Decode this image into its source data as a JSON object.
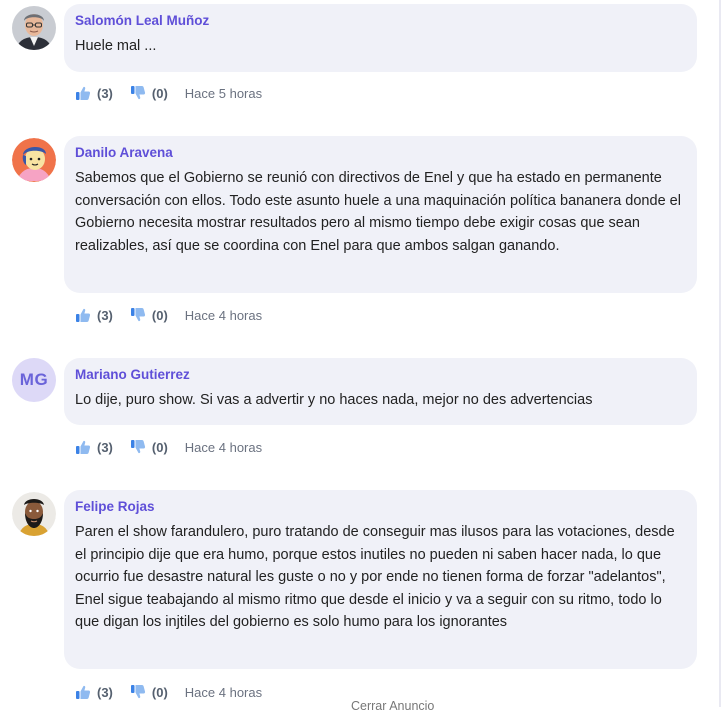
{
  "comments": [
    {
      "author": "Salomón Leal Muñoz",
      "avatar": "photo-man-glasses",
      "text": "Huele mal ...",
      "likes": "(3)",
      "dislikes": "(0)",
      "time": "Hace 5 horas"
    },
    {
      "author": "Danilo Aravena",
      "avatar": "cartoon-avatar-orange",
      "text": "Sabemos que el Gobierno se reunió con directivos de Enel y que ha estado en permanente conversación con ellos. Todo este asunto huele a una maquinación política bananera donde el Gobierno necesita mostrar resultados pero al mismo tiempo debe exigir cosas que sean realizables, así que se coordina con Enel para que ambos salgan ganando.",
      "likes": "(3)",
      "dislikes": "(0)",
      "time": "Hace 4 horas"
    },
    {
      "author": "Mariano Gutierrez",
      "avatar": "initials",
      "initials": "MG",
      "text": "Lo dije, puro show. Si vas a advertir y no haces nada, mejor no des advertencias",
      "likes": "(3)",
      "dislikes": "(0)",
      "time": "Hace 4 horas"
    },
    {
      "author": "Felipe Rojas",
      "avatar": "illustration-bearded-man",
      "text": "Paren el show farandulero, puro tratando de conseguir mas ilusos para las votaciones, desde el principio dije que era humo, porque estos inutiles no pueden ni saben hacer nada, lo que ocurrio fue desastre natural les guste o no y por ende no tienen forma de forzar \"adelantos\", Enel sigue teabajando al mismo ritmo que desde el inicio y va a seguir con su ritmo, todo lo que digan los injtiles del gobierno es solo humo para los ignorantes",
      "likes": "(3)",
      "dislikes": "(0)",
      "time": "Hace 4 horas"
    }
  ],
  "footer": {
    "close_ad": "Cerrar Anuncio"
  },
  "icons": {
    "like": "thumbs-up-icon",
    "dislike": "thumbs-down-icon"
  },
  "colors": {
    "author": "#5f4fd8",
    "bubble": "#f0f1f8",
    "like_icon": "#4f8fe6"
  }
}
